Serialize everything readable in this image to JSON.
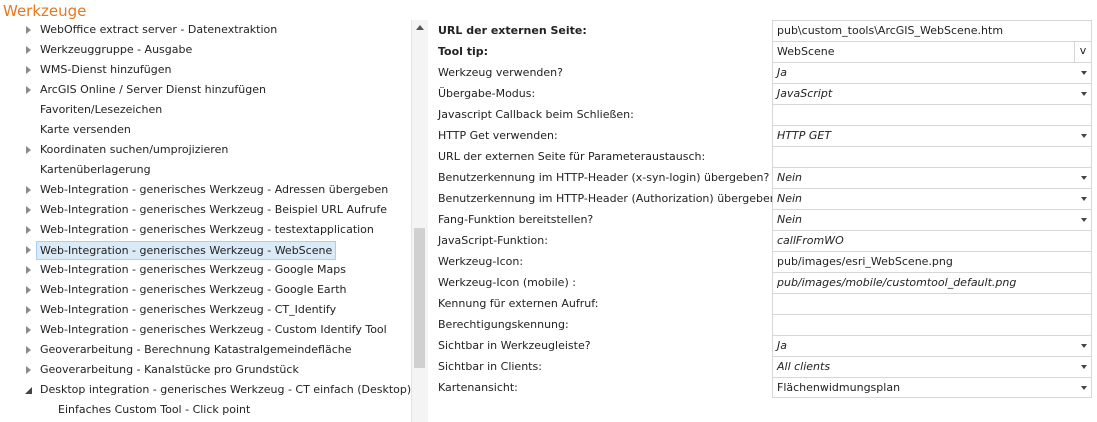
{
  "title": "Werkzeuge",
  "tree": [
    {
      "label": "WebOffice extract server - Datenextraktion",
      "toggle": "collapsed"
    },
    {
      "label": "Werkzeuggruppe - Ausgabe",
      "toggle": "collapsed"
    },
    {
      "label": "WMS-Dienst hinzufügen",
      "toggle": "collapsed"
    },
    {
      "label": "ArcGIS Online / Server Dienst hinzufügen",
      "toggle": "collapsed"
    },
    {
      "label": "Favoriten/Lesezeichen",
      "toggle": "none"
    },
    {
      "label": "Karte versenden",
      "toggle": "none"
    },
    {
      "label": "Koordinaten suchen/umprojizieren",
      "toggle": "collapsed"
    },
    {
      "label": "Kartenüberlagerung",
      "toggle": "none"
    },
    {
      "label": "Web-Integration - generisches Werkzeug - Adressen übergeben",
      "toggle": "collapsed"
    },
    {
      "label": "Web-Integration - generisches Werkzeug - Beispiel URL Aufrufe",
      "toggle": "collapsed"
    },
    {
      "label": "Web-Integration - generisches Werkzeug - testextapplication",
      "toggle": "collapsed"
    },
    {
      "label": "Web-Integration - generisches Werkzeug - WebScene",
      "toggle": "collapsed",
      "selected": true
    },
    {
      "label": "Web-Integration - generisches Werkzeug - Google Maps",
      "toggle": "collapsed"
    },
    {
      "label": "Web-Integration - generisches Werkzeug - Google Earth",
      "toggle": "collapsed"
    },
    {
      "label": "Web-Integration - generisches Werkzeug - CT_Identify",
      "toggle": "collapsed"
    },
    {
      "label": "Web-Integration - generisches Werkzeug - Custom Identify Tool",
      "toggle": "collapsed"
    },
    {
      "label": "Geoverarbeitung - Berechnung Katastralgemeindefläche",
      "toggle": "collapsed"
    },
    {
      "label": "Geoverarbeitung - Kanalstücke pro Grundstück",
      "toggle": "collapsed"
    },
    {
      "label": "Desktop integration - generisches Werkzeug - CT einfach (Desktop)",
      "toggle": "expanded"
    },
    {
      "label": "Einfaches Custom Tool - Click point",
      "toggle": "none",
      "child": true
    }
  ],
  "properties": [
    {
      "label": "URL der externen Seite:",
      "bold": true,
      "value": "pub\\custom_tools\\ArcGIS_WebScene.htm",
      "type": "text",
      "italic": false
    },
    {
      "label": "Tool tip:",
      "bold": true,
      "value": "WebScene",
      "type": "vbutton",
      "button_label": "v",
      "italic": false
    },
    {
      "label": "Werkzeug verwenden?",
      "value": "Ja",
      "type": "dropdown",
      "italic": true
    },
    {
      "label": "Übergabe-Modus:",
      "value": "JavaScript",
      "type": "dropdown",
      "italic": true
    },
    {
      "label": "Javascript Callback beim Schließen:",
      "value": "",
      "type": "text",
      "italic": false
    },
    {
      "label": "HTTP Get verwenden:",
      "value": "HTTP GET",
      "type": "dropdown",
      "italic": true
    },
    {
      "label": "URL der externen Seite für Parameteraustausch:",
      "value": "",
      "type": "text",
      "italic": false
    },
    {
      "label": "Benutzerkennung im HTTP-Header (x-syn-login) übergeben?",
      "value": "Nein",
      "type": "dropdown",
      "italic": true
    },
    {
      "label": "Benutzerkennung im HTTP-Header (Authorization) übergeben?",
      "value": "Nein",
      "type": "dropdown",
      "italic": true
    },
    {
      "label": "Fang-Funktion bereitstellen?",
      "value": "Nein",
      "type": "dropdown",
      "italic": true
    },
    {
      "label": "JavaScript-Funktion:",
      "value": "callFromWO",
      "type": "text",
      "italic": true
    },
    {
      "label": "Werkzeug-Icon:",
      "value": "pub/images/esri_WebScene.png",
      "type": "text",
      "italic": false
    },
    {
      "label": "Werkzeug-Icon (mobile) :",
      "value": "pub/images/mobile/customtool_default.png",
      "type": "text",
      "italic": true
    },
    {
      "label": "Kennung für externen Aufruf:",
      "value": "",
      "type": "text",
      "italic": false
    },
    {
      "label": "Berechtigungskennung:",
      "value": "",
      "type": "text",
      "italic": false
    },
    {
      "label": "Sichtbar in Werkzeugleiste?",
      "value": "Ja",
      "type": "dropdown",
      "italic": true
    },
    {
      "label": "Sichtbar in Clients:",
      "value": "All clients",
      "type": "dropdown",
      "italic": true
    },
    {
      "label": "Kartenansicht:",
      "value": "Flächenwidmungsplan",
      "type": "dropdown",
      "italic": false
    }
  ]
}
